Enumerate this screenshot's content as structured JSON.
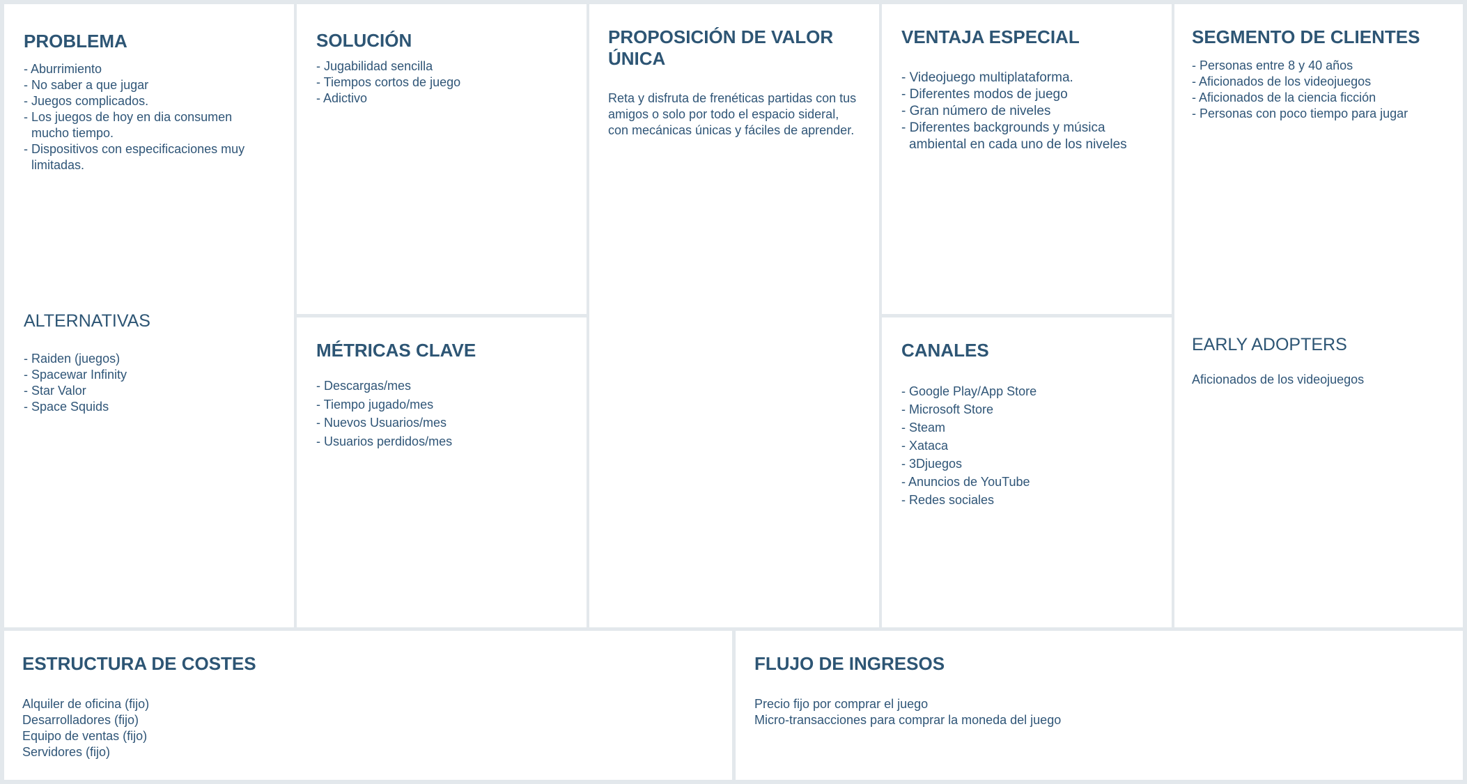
{
  "problema": {
    "title": "PROBLEMA",
    "items": [
      "- Aburrimiento",
      "- No saber a que jugar",
      "- Juegos complicados.",
      "- Los juegos de hoy en dia consumen mucho tiempo.",
      "- Dispositivos con especificaciones muy limitadas."
    ]
  },
  "alternativas": {
    "title": "ALTERNATIVAS",
    "items": [
      "- Raiden (juegos)",
      "- Spacewar Infinity",
      "- Star Valor",
      "- Space Squids"
    ]
  },
  "solucion": {
    "title": "SOLUCIÓN",
    "items": [
      "- Jugabilidad sencilla",
      "- Tiempos cortos de juego",
      "- Adictivo"
    ]
  },
  "metricas": {
    "title": "MÉTRICAS CLAVE",
    "items": [
      "- Descargas/mes",
      "- Tiempo jugado/mes",
      "- Nuevos Usuarios/mes",
      "- Usuarios perdidos/mes"
    ]
  },
  "propuesta": {
    "title": "PROPOSICIÓN DE VALOR ÚNICA",
    "text": "Reta y disfruta de frenéticas partidas con tus amigos o solo por todo el espacio sideral, con mecánicas únicas y fáciles de aprender."
  },
  "ventaja": {
    "title": "VENTAJA ESPECIAL",
    "items": [
      "- Videojuego multiplataforma.",
      "- Diferentes modos de juego",
      "- Gran número de niveles",
      "- Diferentes backgrounds y música ambiental en cada uno de los niveles"
    ]
  },
  "canales": {
    "title": "CANALES",
    "items": [
      "- Google Play/App Store",
      "- Microsoft Store",
      "- Steam",
      "- Xataca",
      "- 3Djuegos",
      "- Anuncios de YouTube",
      "- Redes sociales"
    ]
  },
  "segmento": {
    "title": "SEGMENTO DE CLIENTES",
    "items": [
      "- Personas entre 8 y 40 años",
      "- Aficionados de los videojuegos",
      "- Aficionados de la ciencia ficción",
      "- Personas con poco tiempo para jugar"
    ]
  },
  "early": {
    "title": "EARLY ADOPTERS",
    "text": "Aficionados de los videojuegos"
  },
  "costes": {
    "title": "ESTRUCTURA DE COSTES",
    "items": [
      "Alquiler de oficina (fijo)",
      "Desarrolladores (fijo)",
      "Equipo de ventas (fijo)",
      "Servidores (fijo)"
    ]
  },
  "ingresos": {
    "title": "FLUJO DE INGRESOS",
    "items": [
      "Precio fijo por comprar el juego",
      "Micro-transacciones para comprar la moneda del juego"
    ]
  }
}
